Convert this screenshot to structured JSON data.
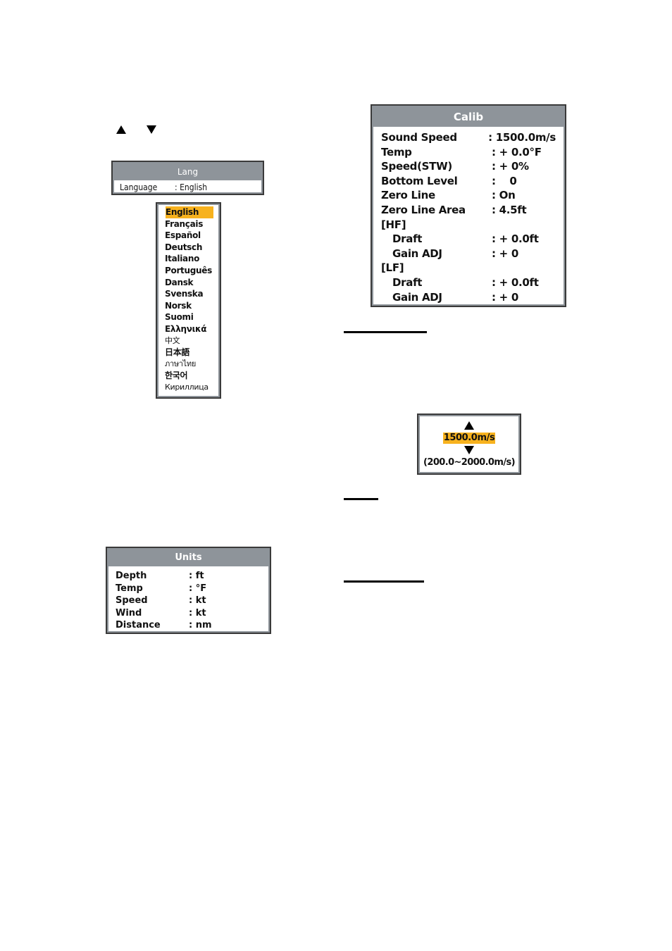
{
  "nav_arrows": {
    "up_icon": "up-triangle",
    "down_icon": "down-triangle"
  },
  "lang_panel": {
    "title": "Lang",
    "rows": [
      {
        "label": "Language",
        "sep": ": ",
        "value": "English"
      }
    ]
  },
  "language_list": {
    "selected": "English",
    "highlight_color": "#f7b21e",
    "items": [
      "English",
      "Français",
      "Español",
      "Deutsch",
      "Italiano",
      "Português",
      "Dansk",
      "Svenska",
      "Norsk",
      "Suomi",
      "Ελληνικά",
      "中文",
      "日本語",
      "ภาษาไทย",
      "한국어",
      "Кириллица"
    ]
  },
  "units_panel": {
    "title": "Units",
    "rows": [
      {
        "label": "Depth",
        "sep": ": ",
        "value": "ft"
      },
      {
        "label": "Temp",
        "sep": ": ",
        "value": "°F"
      },
      {
        "label": "Speed",
        "sep": ": ",
        "value": "kt"
      },
      {
        "label": "Wind",
        "sep": ": ",
        "value": "kt"
      },
      {
        "label": "Distance",
        "sep": ": ",
        "value": "nm"
      }
    ]
  },
  "calib_panel": {
    "title": "Calib",
    "rows": [
      {
        "label": "Sound Speed",
        "sep": ": ",
        "value": "1500.0m/s"
      },
      {
        "label": "Temp",
        "sep": ": ",
        "value": "+ 0.0°F"
      },
      {
        "label": "Speed(STW)",
        "sep": ": ",
        "value": "+ 0%"
      },
      {
        "label": "Bottom Level",
        "sep": ": ",
        "value": "   0"
      },
      {
        "label": "Zero Line",
        "sep": ": ",
        "value": "On"
      },
      {
        "label": "Zero Line Area",
        "sep": ": ",
        "value": "4.5ft"
      }
    ],
    "hf_header": "[HF]",
    "hf_rows": [
      {
        "label": "Draft",
        "sep": ": ",
        "value": "+ 0.0ft"
      },
      {
        "label": "Gain ADJ",
        "sep": ": ",
        "value": "+ 0"
      }
    ],
    "lf_header": "[LF]",
    "lf_rows": [
      {
        "label": "Draft",
        "sep": ": ",
        "value": "+ 0.0ft"
      },
      {
        "label": "Gain ADJ",
        "sep": ": ",
        "value": "+ 0"
      }
    ]
  },
  "adjust_panel": {
    "value": "1500.0m/s",
    "range": "(200.0~2000.0m/s)"
  },
  "colors": {
    "title_bar": "#8e949a",
    "highlight": "#f7b21e",
    "border": "#3a3a3a"
  }
}
